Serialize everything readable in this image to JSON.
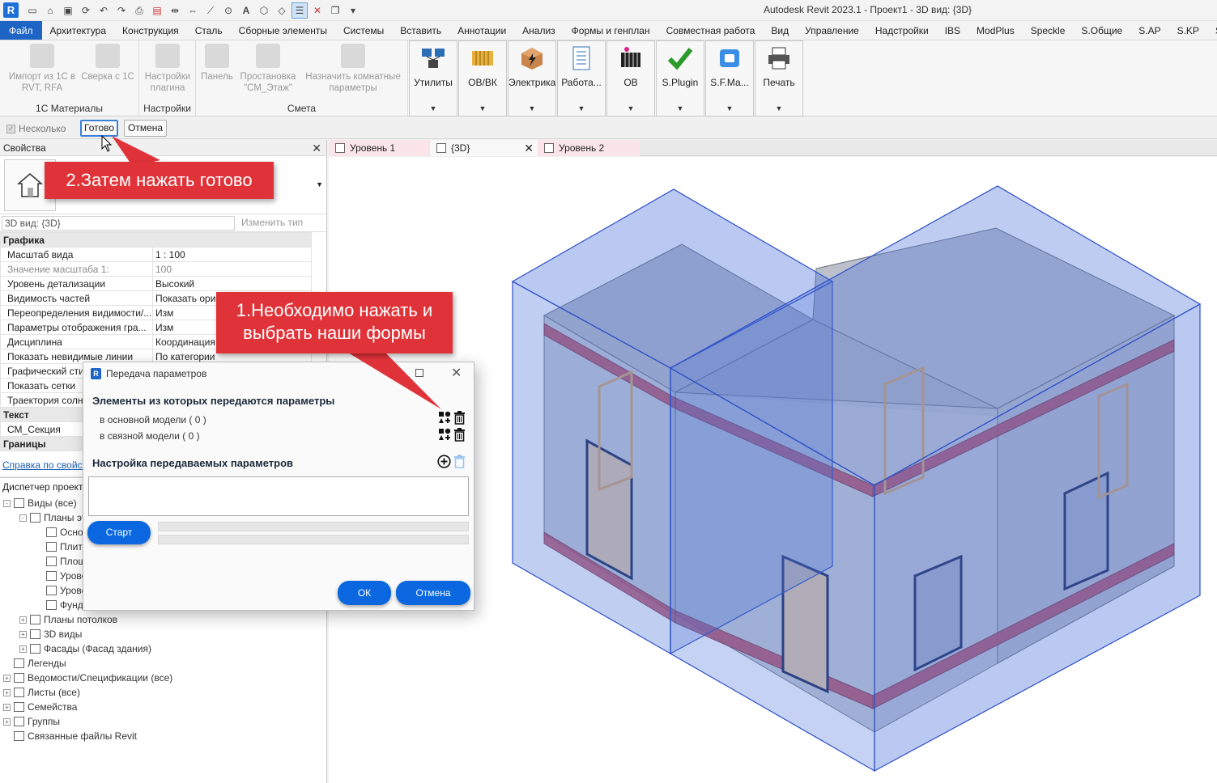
{
  "app": {
    "title": "Autodesk Revit 2023.1 - Проект1 - 3D вид: {3D}",
    "logo_letter": "R"
  },
  "quick_access": [
    "open-icon",
    "save-icon",
    "sync-icon",
    "undo-icon",
    "redo-icon",
    "print-icon",
    "pdf-icon",
    "measure-icon",
    "align-icon",
    "dimension-icon",
    "tag-icon",
    "text-icon",
    "3d-view-icon",
    "section-icon",
    "thin-lines-icon",
    "close-hidden-icon",
    "switch-windows-icon",
    "customize-icon"
  ],
  "ribbon_tabs": [
    "Файл",
    "Архитектура",
    "Конструкция",
    "Сталь",
    "Сборные элементы",
    "Системы",
    "Вставить",
    "Аннотации",
    "Анализ",
    "Формы и генплан",
    "Совместная работа",
    "Вид",
    "Управление",
    "Надстройки",
    "IBS",
    "ModPlus",
    "Speckle",
    "S.Общие",
    "S.AP",
    "S.KP",
    "S.OBK"
  ],
  "ribbon": {
    "groups": [
      {
        "title": "1С Материалы",
        "buttons": [
          "Импорт из 1С в RVT, RFA",
          "Сверка с 1С"
        ]
      },
      {
        "title": "Настройки",
        "buttons": [
          "Настройки плагина"
        ]
      },
      {
        "title": "Смета",
        "buttons": [
          "Панель",
          "Простановка \"СМ_Этаж\"",
          "Назначить комнатные параметры"
        ]
      }
    ],
    "big_buttons": [
      "Утилиты",
      "ОВ/ВК",
      "Электрика",
      "Работа...",
      "ОВ",
      "S.Plugin",
      "S.F.Ма...",
      "Печать"
    ]
  },
  "options_bar": {
    "multiple_label": "Несколько",
    "done_label": "Готово",
    "cancel_label": "Отмена"
  },
  "properties": {
    "title": "Свойства",
    "view_selector": "3D вид: {3D}",
    "edit_type": "Изменить тип",
    "rows": [
      {
        "type": "category",
        "name": "Графика"
      },
      {
        "name": "Масштаб вида",
        "value": "1 : 100"
      },
      {
        "name": "Значение масштаба    1:",
        "value": "100",
        "grey": true
      },
      {
        "name": "Уровень детализации",
        "value": "Высокий"
      },
      {
        "name": "Видимость частей",
        "value": "Показать ори"
      },
      {
        "name": "Переопределения видимости/...",
        "value": "Изм"
      },
      {
        "name": "Параметры отображения гра...",
        "value": "Изм"
      },
      {
        "name": "Дисциплина",
        "value": "Координация"
      },
      {
        "name": "Показать невидимые линии",
        "value": "По категории"
      },
      {
        "name": "Графический сти",
        "value": ""
      },
      {
        "name": "Показать сетки",
        "value": ""
      },
      {
        "name": "Траектория солн",
        "value": ""
      },
      {
        "type": "category",
        "name": "Текст"
      },
      {
        "name": "СМ_Секция",
        "value": ""
      },
      {
        "type": "category",
        "name": "Границы"
      }
    ],
    "help_link": "Справка по свойств"
  },
  "browser": {
    "title": "Диспетчер проект",
    "items": [
      {
        "label": "Виды (все)",
        "level": 0,
        "toggle": "-"
      },
      {
        "label": "Планы эта",
        "level": 1,
        "toggle": "-"
      },
      {
        "label": "Основ",
        "level": 2,
        "toggle": ""
      },
      {
        "label": "Плита",
        "level": 2,
        "toggle": ""
      },
      {
        "label": "Площа",
        "level": 2,
        "toggle": ""
      },
      {
        "label": "Урове",
        "level": 2,
        "toggle": ""
      },
      {
        "label": "Урове",
        "level": 2,
        "toggle": ""
      },
      {
        "label": "Фунд.",
        "level": 2,
        "toggle": ""
      },
      {
        "label": "Планы потолков",
        "level": 1,
        "toggle": "+"
      },
      {
        "label": "3D виды",
        "level": 1,
        "toggle": "+"
      },
      {
        "label": "Фасады (Фасад здания)",
        "level": 1,
        "toggle": "+"
      },
      {
        "label": "Легенды",
        "level": 0,
        "toggle": ""
      },
      {
        "label": "Ведомости/Спецификации (все)",
        "level": 0,
        "toggle": "+"
      },
      {
        "label": "Листы (все)",
        "level": 0,
        "toggle": "+"
      },
      {
        "label": "Семейства",
        "level": 0,
        "toggle": "+"
      },
      {
        "label": "Группы",
        "level": 0,
        "toggle": "+"
      },
      {
        "label": "Связанные файлы Revit",
        "level": 0,
        "toggle": ""
      }
    ]
  },
  "view_tabs": [
    {
      "label": "Уровень 1",
      "active": false
    },
    {
      "label": "{3D}",
      "active": true
    },
    {
      "label": "Уровень 2",
      "active": false
    }
  ],
  "callouts": {
    "step2": "2.Затем нажать готово",
    "step1_line1": "1.Необходимо нажать и",
    "step1_line2": "выбрать наши формы"
  },
  "dialog": {
    "title": "Передача параметров",
    "section1": "Элементы из которых передаются параметры",
    "main_model": "в основной модели ( 0 )",
    "linked_model": "в связной модели ( 0 )",
    "section2": "Настройка передаваемых параметров",
    "start": "Старт",
    "ok": "ОК",
    "cancel": "Отмена"
  },
  "colors": {
    "accent": "#1d64c4",
    "callout_red": "#e03339",
    "dialog_button": "#0a67e0",
    "mass_blue": "#4a72d9",
    "floor_red": "#b8485e"
  }
}
